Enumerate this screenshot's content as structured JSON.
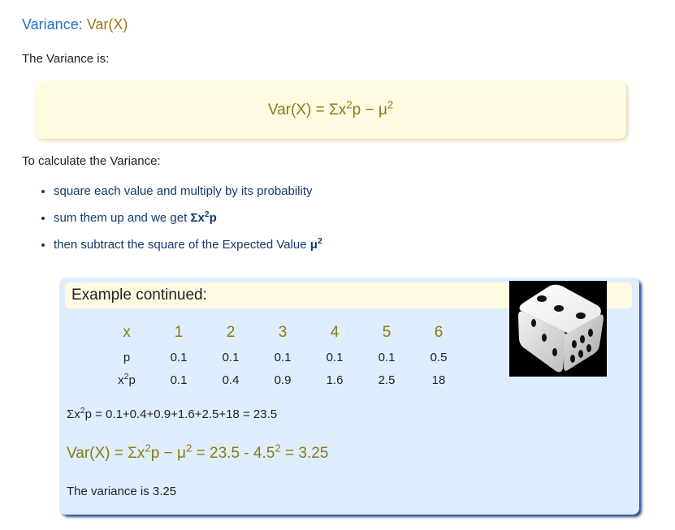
{
  "title": {
    "part1": "Variance",
    "colon": ": ",
    "part2": "Var(X)"
  },
  "intro": "The Variance is:",
  "formula": {
    "lhs": "Var(X) = Σx",
    "p_minus_mu": "p − μ",
    "exp": "2"
  },
  "calc_intro": "To calculate the Variance:",
  "steps": [
    {
      "text": "square each value and multiply by its probability"
    },
    {
      "text": "sum them up and we get ",
      "bold_pre": "Σx",
      "bold_post": "p",
      "exp": "2"
    },
    {
      "text": "then subtract the square of the Expected Value ",
      "bold_pre": "μ",
      "exp": "2"
    }
  ],
  "example": {
    "header": "Example continued:",
    "table": {
      "header_label": "x",
      "x": [
        "1",
        "2",
        "3",
        "4",
        "5",
        "6"
      ],
      "p_label": "p",
      "p": [
        "0.1",
        "0.1",
        "0.1",
        "0.1",
        "0.1",
        "0.5"
      ],
      "x2p_label_pre": "x",
      "x2p_label_post": "p",
      "x2p": [
        "0.1",
        "0.4",
        "0.9",
        "1.6",
        "2.5",
        "18"
      ]
    },
    "sum_line": {
      "pre": "Σx",
      "post": "p = 0.1+0.4+0.9+1.6+2.5+18 = 23.5"
    },
    "var_line": {
      "pre": "Var(X) = Σx",
      "mid": "p − μ",
      "mid2": " = 23.5 - 4.5",
      "post": " = 3.25"
    },
    "result": "The variance is 3.25",
    "exp": "2"
  },
  "colors": {
    "title_blue": "#2c6fb8",
    "gold": "#8a7a12",
    "list_blue": "#123a6e",
    "example_bg": "#dfeeff",
    "formula_bg": "#fffbe3"
  },
  "icons": {
    "dice": "white-die-icon"
  }
}
